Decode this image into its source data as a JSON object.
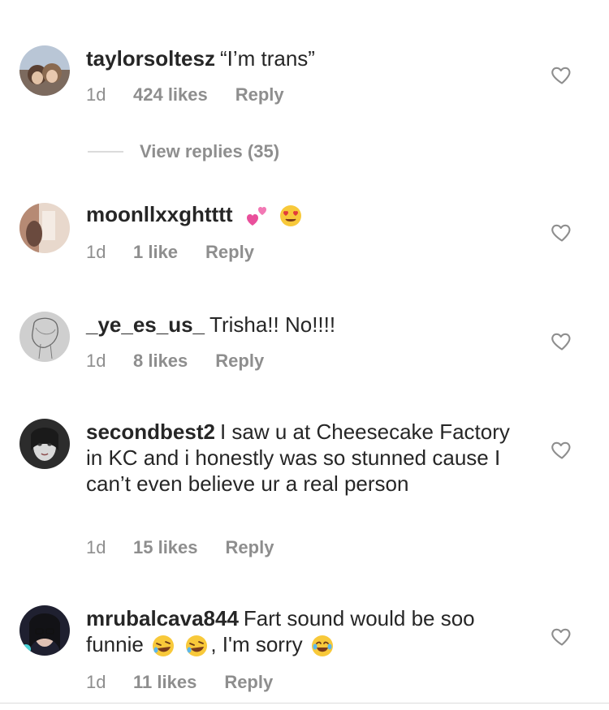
{
  "comments": [
    {
      "username": "taylorsoltesz",
      "text": "“I’m trans”",
      "time": "1d",
      "likes": "424 likes",
      "reply": "Reply"
    },
    {
      "username": "moonllxxghtttt",
      "text": "",
      "emojis": [
        "two-hearts-icon",
        "heart-eyes-icon"
      ],
      "time": "1d",
      "likes": "1 like",
      "reply": "Reply"
    },
    {
      "username": "_ye_es_us_",
      "text": "Trisha!! No!!!!",
      "time": "1d",
      "likes": "8 likes",
      "reply": "Reply"
    },
    {
      "username": "secondbest2",
      "text": "I saw u at Cheesecake Factory in KC and i honestly was so stunned cause I can’t even believe ur a real person",
      "time": "1d",
      "likes": "15 likes",
      "reply": "Reply"
    },
    {
      "username": "mrubalcava844",
      "text_part1": "Fart sound would be soo funnie",
      "text_part2": ", I'm sorry",
      "emojis": [
        "rofl-icon",
        "rofl-icon",
        "joy-icon"
      ],
      "time": "1d",
      "likes": "11 likes",
      "reply": "Reply"
    }
  ],
  "view_replies": "View replies (35)",
  "colors": {
    "text": "#262626",
    "meta": "#8e8e8e",
    "divider": "#dbdbdb"
  }
}
